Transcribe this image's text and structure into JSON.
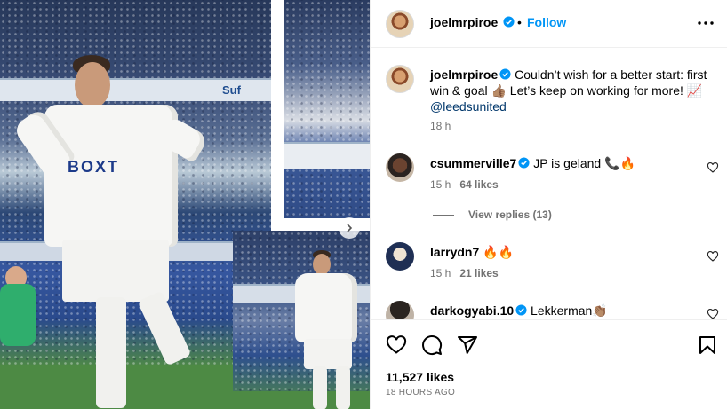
{
  "post": {
    "author": "joelmrpiroe",
    "follow_label": "Follow",
    "separator": "•"
  },
  "media": {
    "board_text_1": "BOXT",
    "board_text_2": "Suf"
  },
  "caption": {
    "username": "joelmrpiroe",
    "text": "Couldn’t wish for a better start: first win & goal 👍🏽 Let’s keep on working for more! 📈",
    "mention": "@leedsunited",
    "time": "18 h"
  },
  "comments": [
    {
      "username": "csummerville7",
      "text": "JP is geland 📞🔥",
      "time": "15 h",
      "likes": "64 likes"
    },
    {
      "username": "larrydn7",
      "text": "🔥🔥",
      "time": "15 h",
      "likes": "21 likes"
    },
    {
      "username": "darkogyabi.10",
      "text": "Lekkerman👏🏽",
      "time": "",
      "likes": ""
    }
  ],
  "view_replies": "View replies (13)",
  "footer": {
    "likes": "11,527 likes",
    "timestamp": "18 HOURS AGO"
  },
  "icons": {
    "verified": "verified-badge-icon",
    "more": "more-options-icon",
    "heart": "heart-icon",
    "comment": "comment-icon",
    "share": "share-icon",
    "save": "bookmark-icon",
    "next": "chevron-right-icon"
  },
  "colors": {
    "accent": "#0095f6",
    "secondary_text": "#737373",
    "mention": "#00376b",
    "leeds_blue": "#1d3b8a"
  }
}
